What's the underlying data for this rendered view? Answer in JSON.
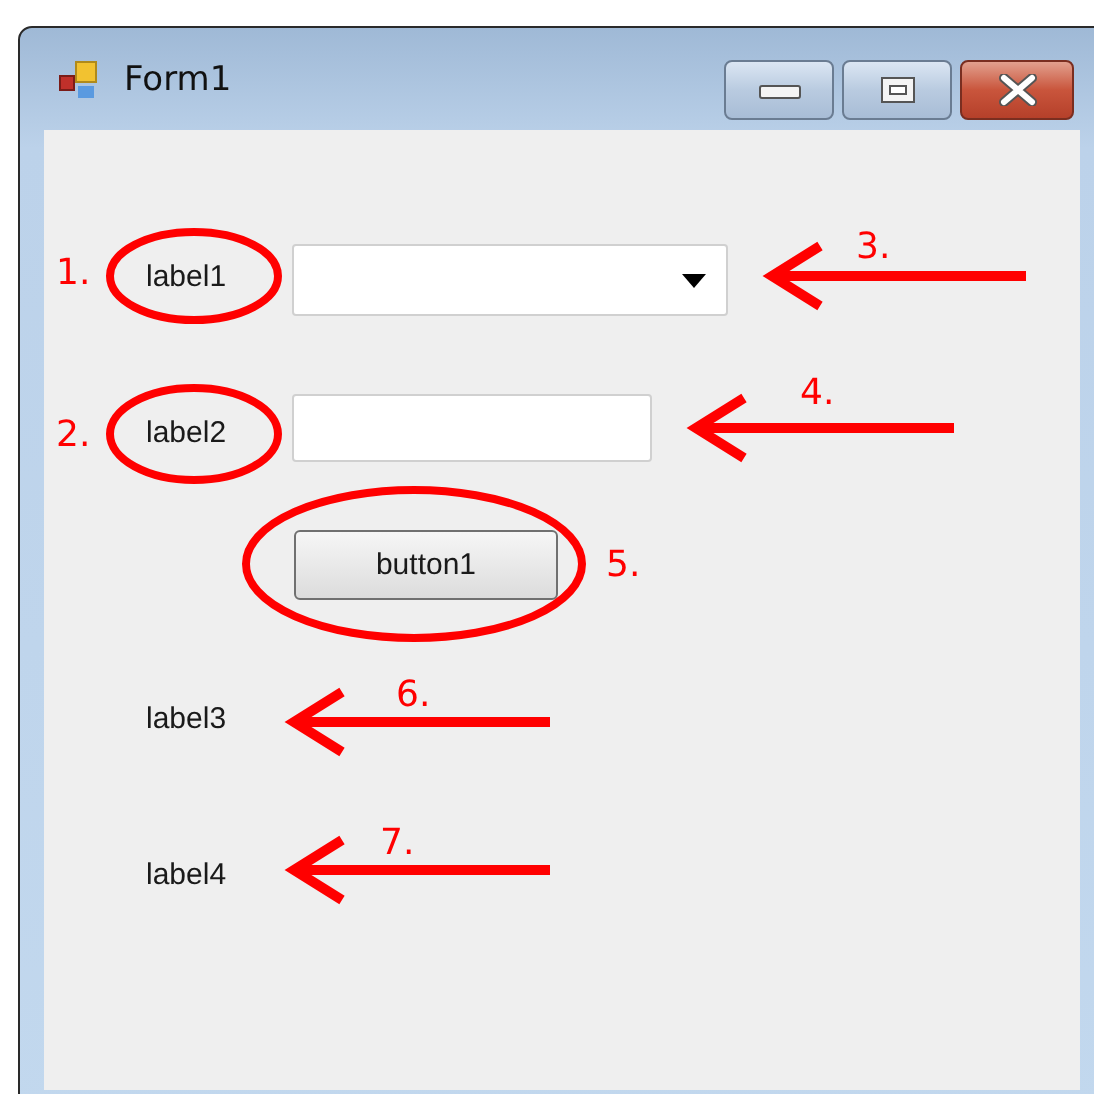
{
  "window": {
    "title": "Form1"
  },
  "controls": [
    {
      "kind": "label",
      "text": "label1"
    },
    {
      "kind": "combobox"
    },
    {
      "kind": "label",
      "text": "label2"
    },
    {
      "kind": "textbox"
    },
    {
      "kind": "button",
      "text": "button1"
    },
    {
      "kind": "label",
      "text": "label3"
    },
    {
      "kind": "label",
      "text": "label4"
    }
  ],
  "annotations": [
    {
      "kind": "ellipse",
      "label": "1."
    },
    {
      "kind": "ellipse",
      "label": "2."
    },
    {
      "kind": "arrow",
      "label": "3."
    },
    {
      "kind": "arrow",
      "label": "4."
    },
    {
      "kind": "ellipse",
      "label": "5."
    },
    {
      "kind": "arrow",
      "label": "6."
    },
    {
      "kind": "arrow",
      "label": "7."
    }
  ]
}
